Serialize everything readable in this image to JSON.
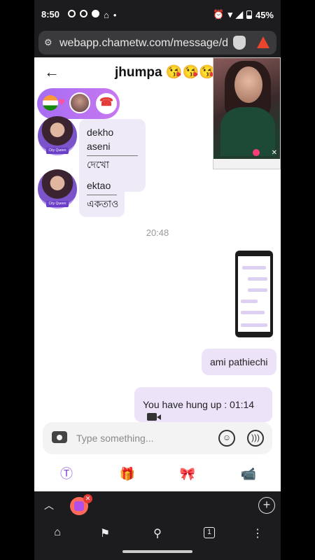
{
  "status_bar": {
    "time": "8:50",
    "battery": "45%"
  },
  "browser": {
    "url": "webapp.chametw.com/message/de",
    "tab_count": "1"
  },
  "chat": {
    "title": "jhumpa 😘😘😘",
    "incoming": [
      {
        "line1": "dekho aseni",
        "line2": "দেখো আসেনি"
      },
      {
        "line1": "ektao",
        "line2": "একতাও"
      }
    ],
    "timestamp": "20:48",
    "outgoing": [
      {
        "text": "ami pathiechi"
      },
      {
        "text": "You have hung up : 01:14"
      }
    ],
    "avatar_badge": "City Queen"
  },
  "composer": {
    "placeholder": "Type something..."
  },
  "colors": {
    "accent": "#a66cf3",
    "bubble_out": "#ece3f9",
    "bubble_in": "#efeaf8",
    "hangup": "#e53935"
  },
  "icons": [
    "back-arrow-icon",
    "camera-icon",
    "emoji-icon",
    "voice-icon",
    "translate-icon",
    "gift-box-icon",
    "gift-icon",
    "video-call-icon",
    "home-icon",
    "bookmark-icon",
    "search-icon",
    "more-icon"
  ]
}
